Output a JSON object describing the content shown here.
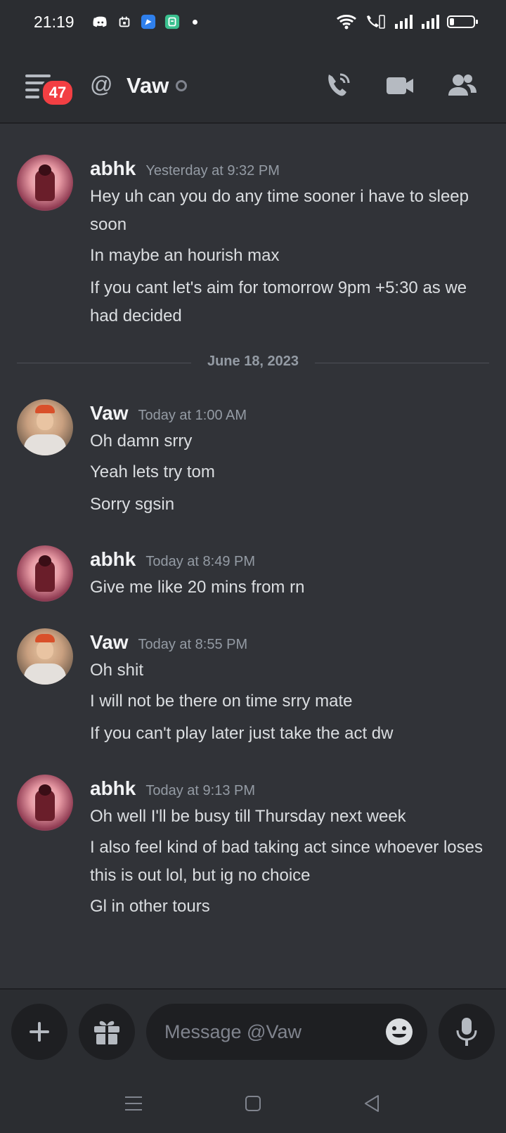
{
  "status_bar": {
    "time": "21:19",
    "left_icons": [
      "discord-icon",
      "calendar-icon",
      "app-blue-icon",
      "app-green-icon"
    ],
    "right_icons": [
      "wifi-icon",
      "volte-call-icon",
      "signal-1-icon",
      "signal-2-icon",
      "battery-icon"
    ],
    "battery_level": 0.2
  },
  "header": {
    "unread_badge": "47",
    "at_symbol": "@",
    "channel_name": "Vaw",
    "icons": [
      "phone-call-icon",
      "video-camera-icon",
      "members-icon"
    ]
  },
  "messages": [
    {
      "author": "abhk",
      "timestamp": "Yesterday at 9:32 PM",
      "lines": [
        "Hey uh can you do any time sooner i have to sleep soon",
        "In maybe an hourish max",
        "If you cant let's aim for tomorrow 9pm +5:30 as we had decided"
      ]
    },
    {
      "author": "Vaw",
      "timestamp": "Today at 1:00 AM",
      "lines": [
        "Oh damn srry",
        "Yeah lets try tom",
        "Sorry sgsin"
      ]
    },
    {
      "author": "abhk",
      "timestamp": "Today at 8:49 PM",
      "lines": [
        "Give me like 20 mins from rn"
      ]
    },
    {
      "author": "Vaw",
      "timestamp": "Today at 8:55 PM",
      "lines": [
        "Oh shit",
        "I will not be there on time srry mate",
        "If you can't play later just take the act dw"
      ]
    },
    {
      "author": "abhk",
      "timestamp": "Today at 9:13 PM",
      "lines": [
        "Oh well I'll be busy till Thursday next week",
        "I also feel kind of bad taking act since whoever loses this is out lol, but ig no choice",
        "Gl in other tours"
      ]
    }
  ],
  "date_divider": "June 18, 2023",
  "composer": {
    "placeholder": "Message @Vaw",
    "icons": [
      "plus-icon",
      "gift-icon",
      "emoji-icon",
      "microphone-icon"
    ]
  },
  "nav_bar": {
    "icons": [
      "menu-icon",
      "home-icon",
      "back-icon"
    ]
  },
  "colors": {
    "background": "#313338",
    "header": "#2b2d31",
    "badge": "#f23f43",
    "input": "#1e1f22"
  }
}
